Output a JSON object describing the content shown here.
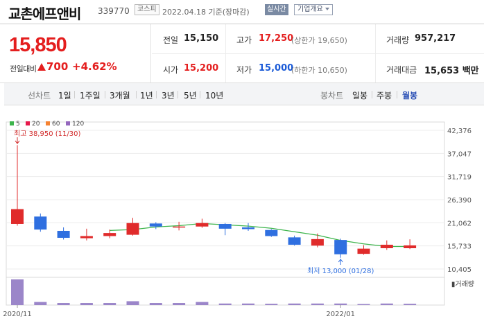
{
  "header": {
    "stock_name": "교촌에프앤비",
    "stock_code": "339770",
    "market_badge": "코스피",
    "date_text": "2022.04.18  기준(장마감)",
    "realtime_badge": "실시간",
    "company_button": "기업개요"
  },
  "summary": {
    "current_price": "15,850",
    "prev_label": "전일대비",
    "change_value": "700",
    "change_percent": "+4.62%",
    "prev_close_label": "전일",
    "prev_close_value": "15,150",
    "high_label": "고가",
    "high_value": "17,250",
    "upper_limit": "(상한가 19,650)",
    "volume_label": "거래량",
    "volume_value": "957,217",
    "open_label": "시가",
    "open_value": "15,200",
    "low_label": "저가",
    "low_value": "15,000",
    "lower_limit": "(하한가 10,650)",
    "amount_label": "거래대금",
    "amount_value": "15,653 백만"
  },
  "toolbar": {
    "line_chart_label": "선차트",
    "periods": [
      "1일",
      "1주일",
      "3개월",
      "1년",
      "3년",
      "5년",
      "10년"
    ],
    "candle_label": "봉차트",
    "candle_options": [
      "일봉",
      "주봉",
      "월봉"
    ],
    "active_candle": "월봉"
  },
  "chart_data": {
    "type": "candlestick",
    "legend": [
      {
        "name": "5",
        "color": "#3cb44b"
      },
      {
        "name": "20",
        "color": "#e6194b"
      },
      {
        "name": "60",
        "color": "#f58231"
      },
      {
        "name": "120",
        "color": "#9467bd"
      }
    ],
    "y_ticks": [
      "42,376",
      "37,047",
      "31,719",
      "26,390",
      "21,062",
      "15,733",
      "10,405"
    ],
    "y_tick_values": [
      42376,
      37047,
      31719,
      26390,
      21062,
      15733,
      10405
    ],
    "x_labels": [
      {
        "label": "2020/11",
        "index": 0
      },
      {
        "label": "2022/01",
        "index": 14
      }
    ],
    "high_annotation": "최고 38,950 (11/30)",
    "low_annotation": "최저 13,000 (01/28)",
    "volume_label": "거래량",
    "candles": [
      {
        "o": 20800,
        "h": 38950,
        "l": 20400,
        "c": 24200
      },
      {
        "o": 22500,
        "h": 23200,
        "l": 19000,
        "c": 19500
      },
      {
        "o": 19200,
        "h": 20000,
        "l": 17200,
        "c": 17600
      },
      {
        "o": 17500,
        "h": 19700,
        "l": 17000,
        "c": 18000
      },
      {
        "o": 18000,
        "h": 19500,
        "l": 17500,
        "c": 18700
      },
      {
        "o": 18300,
        "h": 22200,
        "l": 18100,
        "c": 21000
      },
      {
        "o": 20900,
        "h": 21200,
        "l": 19600,
        "c": 20200
      },
      {
        "o": 20000,
        "h": 21300,
        "l": 19300,
        "c": 20200
      },
      {
        "o": 20200,
        "h": 22000,
        "l": 19900,
        "c": 21000
      },
      {
        "o": 20800,
        "h": 21000,
        "l": 18200,
        "c": 19700
      },
      {
        "o": 20000,
        "h": 21000,
        "l": 19200,
        "c": 19600
      },
      {
        "o": 19400,
        "h": 19600,
        "l": 17800,
        "c": 18000
      },
      {
        "o": 17700,
        "h": 18100,
        "l": 15800,
        "c": 16000
      },
      {
        "o": 15800,
        "h": 18600,
        "l": 15400,
        "c": 17300
      },
      {
        "o": 17100,
        "h": 17400,
        "l": 13000,
        "c": 13800
      },
      {
        "o": 13900,
        "h": 15900,
        "l": 13700,
        "c": 15100
      },
      {
        "o": 15200,
        "h": 17000,
        "l": 14800,
        "c": 16000
      },
      {
        "o": 15200,
        "h": 17250,
        "l": 15000,
        "c": 15850
      }
    ],
    "ma5": [
      null,
      null,
      null,
      null,
      19300,
      19500,
      20100,
      20400,
      20900,
      20600,
      20300,
      19800,
      19000,
      18200,
      17000,
      16200,
      15600,
      15600
    ],
    "volume": [
      100,
      12,
      8,
      8,
      8,
      15,
      8,
      8,
      12,
      6,
      6,
      5,
      6,
      6,
      6,
      4,
      6,
      5
    ]
  }
}
